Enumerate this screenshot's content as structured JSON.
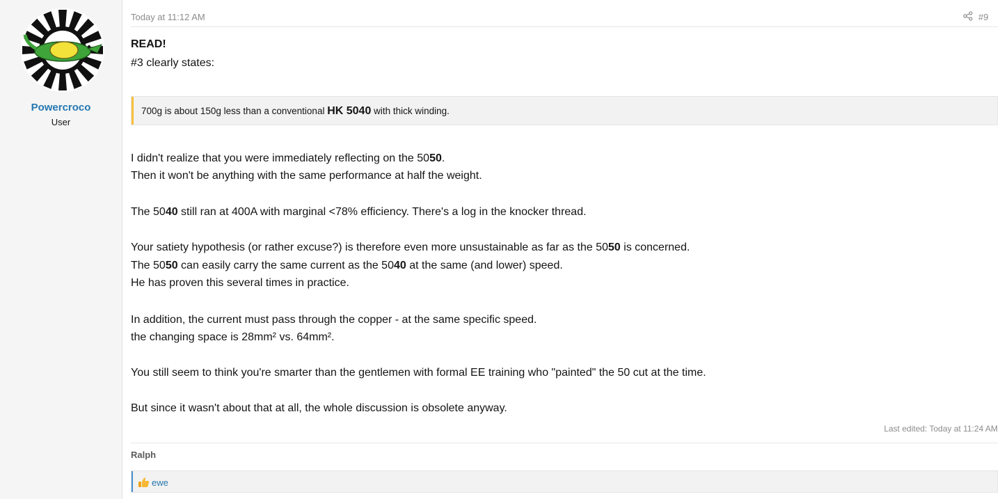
{
  "author": {
    "name": "Powercroco",
    "title": "User"
  },
  "post": {
    "date": "Today at 11:12 AM",
    "number": "#9"
  },
  "content": {
    "heading": "READ!",
    "intro": "#3 clearly states:",
    "quote": {
      "before": "700g is about 150g less than a conventional ",
      "bold": "HK 5040",
      "after": " with thick winding."
    },
    "p1": {
      "a": "I didn't realize that you were immediately reflecting on the 50",
      "b": "50",
      "c": "."
    },
    "p2": "Then it won't be anything with the same performance at half the weight.",
    "p3": {
      "a": "The 50",
      "b": "40",
      "c": " still ran at 400A with marginal <78% efficiency. There's a log in the knocker thread."
    },
    "p4": {
      "a": "Your satiety hypothesis (or rather excuse?) is therefore even more unsustainable as far as the 50",
      "b": "50",
      "c": " is concerned."
    },
    "p5": {
      "a": "The 50",
      "b": "50",
      "c": " can easily carry the same current as the 50",
      "d": "40",
      "e": " at the same (and lower) speed."
    },
    "p6": "He has proven this several times in practice.",
    "p7": "In addition, the current must pass through the copper - at the same specific speed.",
    "p8": "the changing space is 28mm² vs. 64mm².",
    "p9": "You still seem to think you're smarter than the gentlemen with formal EE training who \"painted\" the 50 cut at the time.",
    "p10": "But since it wasn't about that at all, the whole discussion is obsolete anyway."
  },
  "edited": "Last edited: Today at 11:24 AM",
  "signature": "Ralph",
  "reactions": {
    "users": "ewe",
    "icon": "like-icon"
  },
  "colors": {
    "link": "#2577b1",
    "quote_bar": "#f9bf3b",
    "reaction_bar": "#4a8fd1"
  }
}
